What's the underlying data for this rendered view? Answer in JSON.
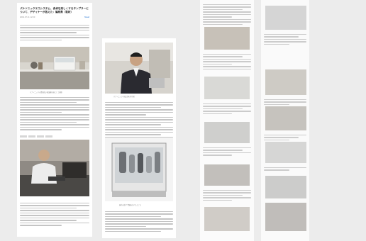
{
  "article": {
    "title": "パナソニックエコシステム、食卓を楽しくするタンブラーについて、デザイナーが答えた：篠原勇（取材）",
    "meta": "2019.07.11 12:00",
    "share_label": "Tweet",
    "caption_1": "パナソニックの食器洗い乾燥機を前にして撮影",
    "caption_2": "パナソニック 商品企画 担当者",
    "caption_3": "庫内の様子 食器を並べたところ"
  },
  "colors": {
    "page_bg": "#ececec",
    "sheet_bg": "#ffffff",
    "text": "#222222",
    "link": "#1d6fd0"
  }
}
